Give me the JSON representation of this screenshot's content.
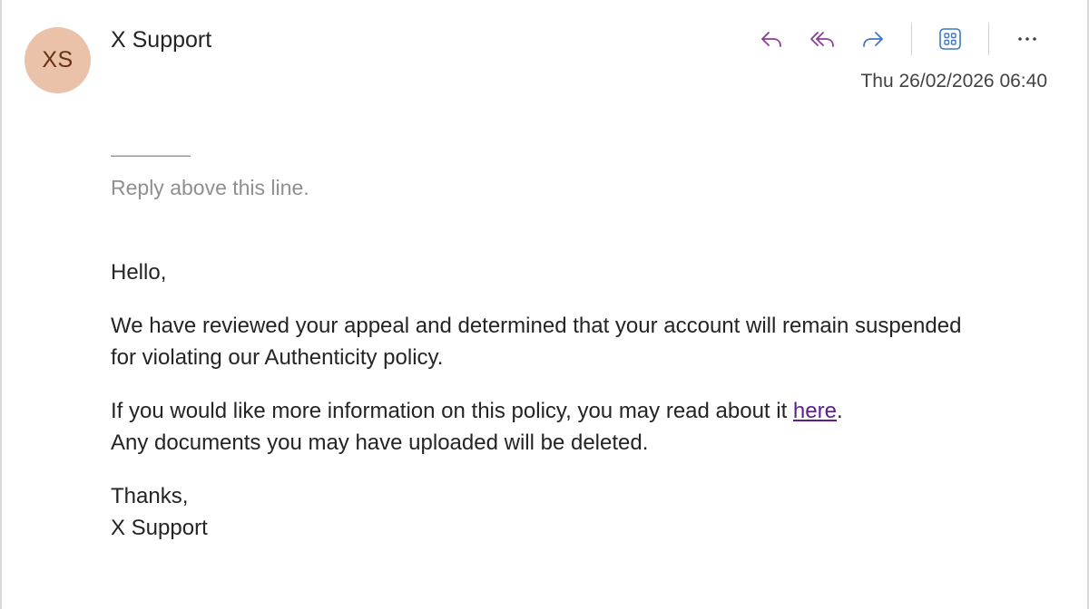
{
  "avatar": {
    "initials": "XS",
    "color": "#eac2a9"
  },
  "header": {
    "sender": "X Support",
    "timestamp": "Thu 26/02/2026 06:40"
  },
  "toolbar": {
    "icons": [
      "reply-icon",
      "reply-all-icon",
      "forward-icon",
      "apps-icon",
      "more-icon"
    ],
    "accent_reply": "#8b3a9a",
    "accent_forward": "#3b78c7",
    "more_label": "···"
  },
  "body": {
    "reply_dashes": "————",
    "reply_prompt": "Reply above this line.",
    "greeting": "Hello,",
    "para1_line1": "We have reviewed your appeal and determined that your account will remain suspended",
    "para1_line2": "for violating our Authenticity policy.",
    "para2_pre": "If you would like more information on this policy, you may read about it ",
    "para2_link": "here",
    "para2_post": ".",
    "para2_line2": "Any documents you may have uploaded will be deleted.",
    "closing": "Thanks,",
    "signature": "X Support",
    "link_color": "#5b1f8f"
  }
}
